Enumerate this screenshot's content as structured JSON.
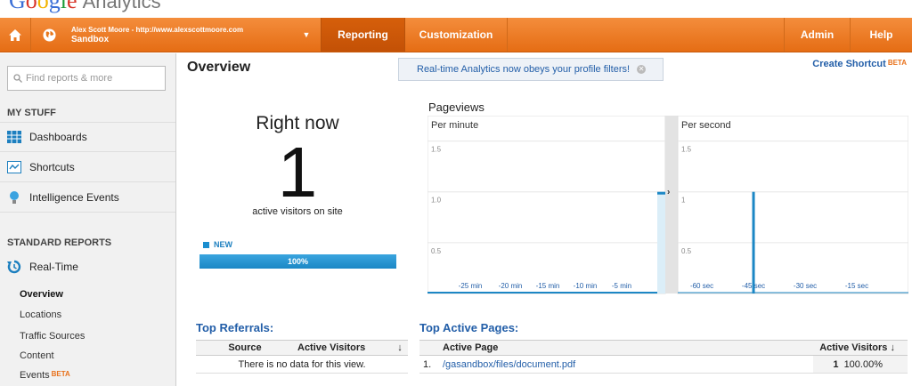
{
  "brand": {
    "logo_word": "Google",
    "product": "Analytics"
  },
  "topbar": {
    "account_line1": "Alex Scott Moore - http://www.alexscottmoore.com",
    "account_line2": "Sandbox",
    "reporting": "Reporting",
    "customization": "Customization",
    "admin": "Admin",
    "help": "Help"
  },
  "sidebar": {
    "search_placeholder": "Find reports & more",
    "my_stuff": "MY STUFF",
    "dashboards": "Dashboards",
    "shortcuts": "Shortcuts",
    "intelligence_events": "Intelligence Events",
    "standard_reports": "STANDARD REPORTS",
    "realtime": "Real-Time",
    "sub": [
      "Overview",
      "Locations",
      "Traffic Sources",
      "Content",
      "Events"
    ],
    "beta": "BETA"
  },
  "main": {
    "title": "Overview",
    "notice": "Real-time Analytics now obeys your profile filters!",
    "create_shortcut": "Create Shortcut",
    "beta": "BETA",
    "right_now_label": "Right now",
    "right_now_count": "1",
    "right_now_sub": "active visitors on site",
    "new_label": "NEW",
    "new_percent": 100,
    "new_percent_text": "100%",
    "pageviews_title": "Pageviews"
  },
  "chart_data": [
    {
      "type": "bar",
      "title": "Per minute",
      "y_ticks": [
        "1.5",
        "1.0",
        "0.5"
      ],
      "x_ticks": [
        "-25 min",
        "-20 min",
        "-15 min",
        "-10 min",
        "-5 min"
      ],
      "ylim": [
        0,
        1.75
      ],
      "values_note": "",
      "current_value": 1
    },
    {
      "type": "bar",
      "title": "Per second",
      "y_ticks": [
        "1.5",
        "1",
        "0.5"
      ],
      "x_ticks": [
        "-60 sec",
        "-45 sec",
        "-30 sec",
        "-15 sec"
      ],
      "ylim": [
        0,
        1.75
      ],
      "spike": {
        "x": -45,
        "value": 1
      }
    }
  ],
  "referrals": {
    "title": "Top Referrals:",
    "col_source": "Source",
    "col_visitors": "Active Visitors",
    "empty": "There is no data for this view."
  },
  "pages": {
    "title": "Top Active Pages:",
    "col_page": "Active Page",
    "col_visitors": "Active Visitors",
    "rows": [
      {
        "num": "1.",
        "page": "/gasandbox/files/document.pdf",
        "visitors": "1",
        "pct": "100.00%"
      }
    ]
  }
}
